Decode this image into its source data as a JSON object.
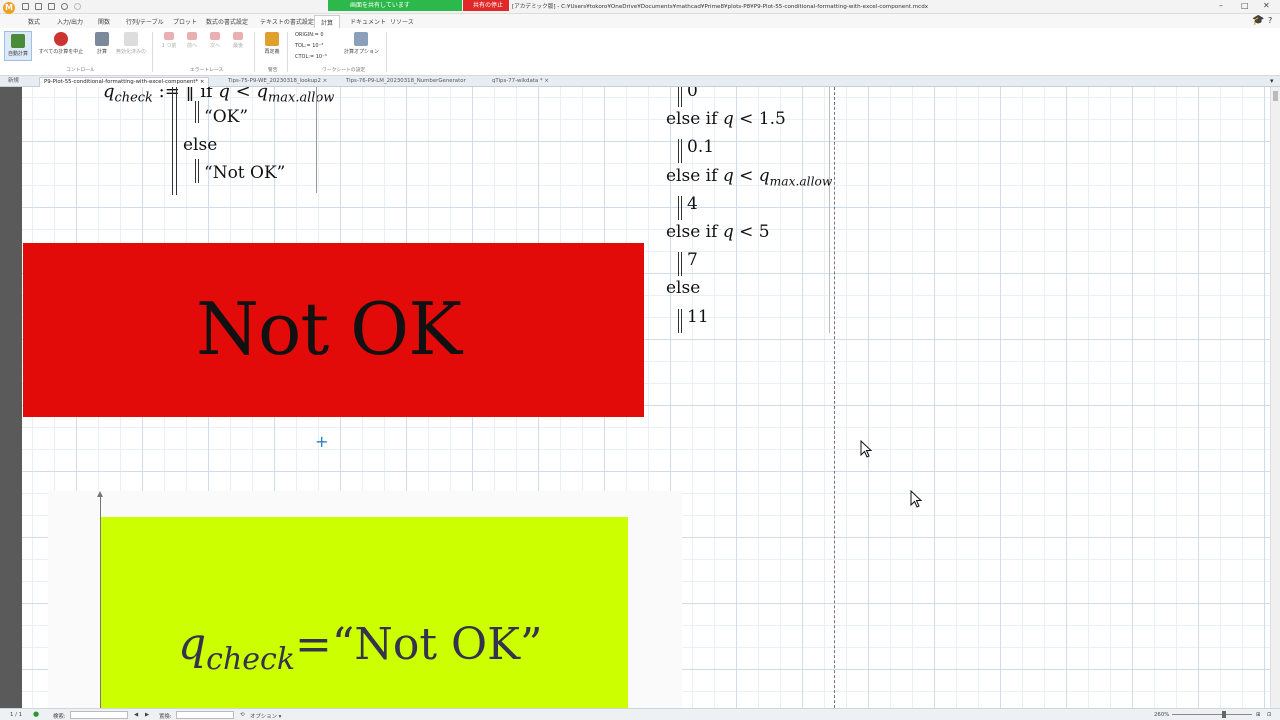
{
  "titlebar": {
    "app_logo": "M",
    "share_banner": "画面を共有しています",
    "stop_share": "共有の停止",
    "doc_path": "[アカデミック版] - C:¥Users¥tokoro¥OneDrive¥Documents¥mathcad¥Prime8¥plots-P8¥P9-Plot-55-conditional-formatting-with-excel-component.mcdx",
    "minimize_icon": "minimize-icon",
    "maximize_icon": "maximize-icon",
    "close_icon": "close-icon"
  },
  "ribbon_tabs": [
    "数式",
    "入力/出力",
    "関数",
    "行列/テーブル",
    "プロット",
    "数式の書式設定",
    "テキストの書式設定",
    "計算",
    "ドキュメント",
    "リソース"
  ],
  "ribbon_active_tab": "計算",
  "ribbon": {
    "auto_calc": "自動計算",
    "stop_all": "すべての計算を中止",
    "calc": "計算",
    "disabled_calc": "無効化済みの",
    "control_group": "コントロール",
    "trace_btns": [
      "1 つ前",
      "前へ",
      "次へ",
      "最後"
    ],
    "error_trace_group": "エラートレース",
    "redefine": "再定義",
    "warning_group": "警告",
    "origin": "ORIGIN:=  0",
    "tol": "TOL:=  10⁻³",
    "ctol": "CTOL:=  10⁻³",
    "calc_options": "計算オプション",
    "worksheet_settings_group": "ワークシートの設定"
  },
  "doc_tabs": [
    "新規",
    "P9-Plot-55-conditional-formatting-with-excel-component* ×",
    "Tips-75-P9-WE_20230318_lookup2 ×",
    "Tips-76-P9-LM_20230318_NumberGenerator",
    "qTips-77-wikdata * ×"
  ],
  "worksheet": {
    "qcheck_def_var": "q",
    "qcheck_def_sub": "check",
    "qcheck_def_op": ":= ‖ if",
    "qcheck_def_cond_q": "q",
    "qcheck_def_cond_lt": "<",
    "qcheck_def_cond_qmax": "q",
    "qcheck_def_cond_sub": "max.allow",
    "ok_string": "“OK”",
    "else_1": "else",
    "notok_string": "“Not OK”",
    "right_lines": [
      {
        "kw": "",
        "q": "",
        "op": "",
        "val": "0",
        "sub": "",
        "indent": true
      },
      {
        "kw": "else if",
        "q": "q",
        "op": "<",
        "val": "1.5",
        "sub": "",
        "indent": false
      },
      {
        "kw": "",
        "q": "",
        "op": "",
        "val": "0.1",
        "sub": "",
        "indent": true
      },
      {
        "kw": "else if",
        "q": "q",
        "op": "<",
        "val": "q",
        "sub": "max.allow",
        "indent": false
      },
      {
        "kw": "",
        "q": "",
        "op": "",
        "val": "4",
        "sub": "",
        "indent": true
      },
      {
        "kw": "else if",
        "q": "q",
        "op": "<",
        "val": "5",
        "sub": "",
        "indent": false
      },
      {
        "kw": "",
        "q": "",
        "op": "",
        "val": "7",
        "sub": "",
        "indent": true
      },
      {
        "kw": "else",
        "q": "",
        "op": "",
        "val": "",
        "sub": "",
        "indent": false
      },
      {
        "kw": "",
        "q": "",
        "op": "",
        "val": "11",
        "sub": "",
        "indent": true
      }
    ],
    "big_label": "Not OK",
    "result_var": "q",
    "result_sub": "check",
    "result_eq": "=",
    "result_val": "“Not OK”",
    "crosshair": "+"
  },
  "statusbar": {
    "page": "1 / 1",
    "search_label": "検索:",
    "replace_label": "置換:",
    "options": "オプション ▾",
    "zoom": "260%"
  },
  "colors": {
    "notok_bg": "#e30a0a",
    "result_bg": "#ccff00",
    "share_green": "#2db84c",
    "stop_red": "#e02828"
  }
}
